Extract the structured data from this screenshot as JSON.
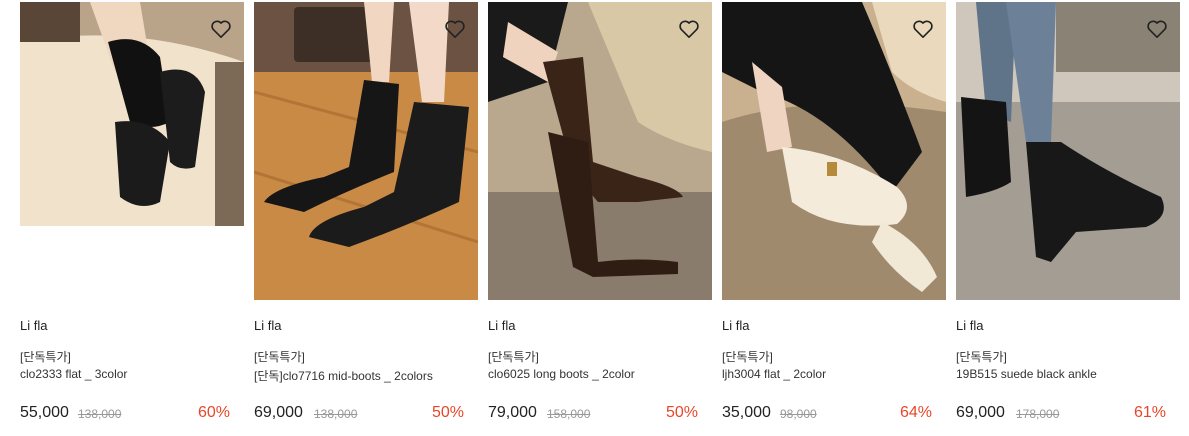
{
  "products": [
    {
      "brand": "Li fla",
      "tag": "[단독특가]",
      "name": "clo2333 flat _ 3color",
      "price": "55,000",
      "original_price": "138,000",
      "discount": "60%",
      "image": {
        "background": "#ead9c0",
        "description": "black square-toe flat with black socks on beige cushion"
      }
    },
    {
      "brand": "Li fla",
      "tag": "[단독특가]",
      "name": "[단독]clo7716 mid-boots _ 2colors",
      "price": "69,000",
      "original_price": "138,000",
      "discount": "50%",
      "image": {
        "background": "#c98a46",
        "description": "black leather mid-calf boots on wooden floor"
      }
    },
    {
      "brand": "Li fla",
      "tag": "[단독특가]",
      "name": "clo6025 long boots _ 2color",
      "price": "79,000",
      "original_price": "158,000",
      "discount": "50%",
      "image": {
        "background": "#8a7c6c",
        "description": "brown knee-high long boots near ornate chair"
      }
    },
    {
      "brand": "Li fla",
      "tag": "[단독특가]",
      "name": "ljh3004 flat _ 2color",
      "price": "35,000",
      "original_price": "98,000",
      "discount": "64%",
      "image": {
        "background": "#c9b08e",
        "description": "ivory mary-jane flat with buckle strap"
      }
    },
    {
      "brand": "Li fla",
      "tag": "[단독특가]",
      "name": "19B515 suede black ankle",
      "price": "69,000",
      "original_price": "178,000",
      "discount": "61%",
      "image": {
        "background": "#a39d93",
        "description": "black suede ankle boots with block heel and jeans"
      }
    }
  ],
  "colors": {
    "discount": "#e8462a",
    "original_price": "#999999",
    "text": "#222222"
  },
  "icons": {
    "wishlist": "heart-outline-icon"
  }
}
